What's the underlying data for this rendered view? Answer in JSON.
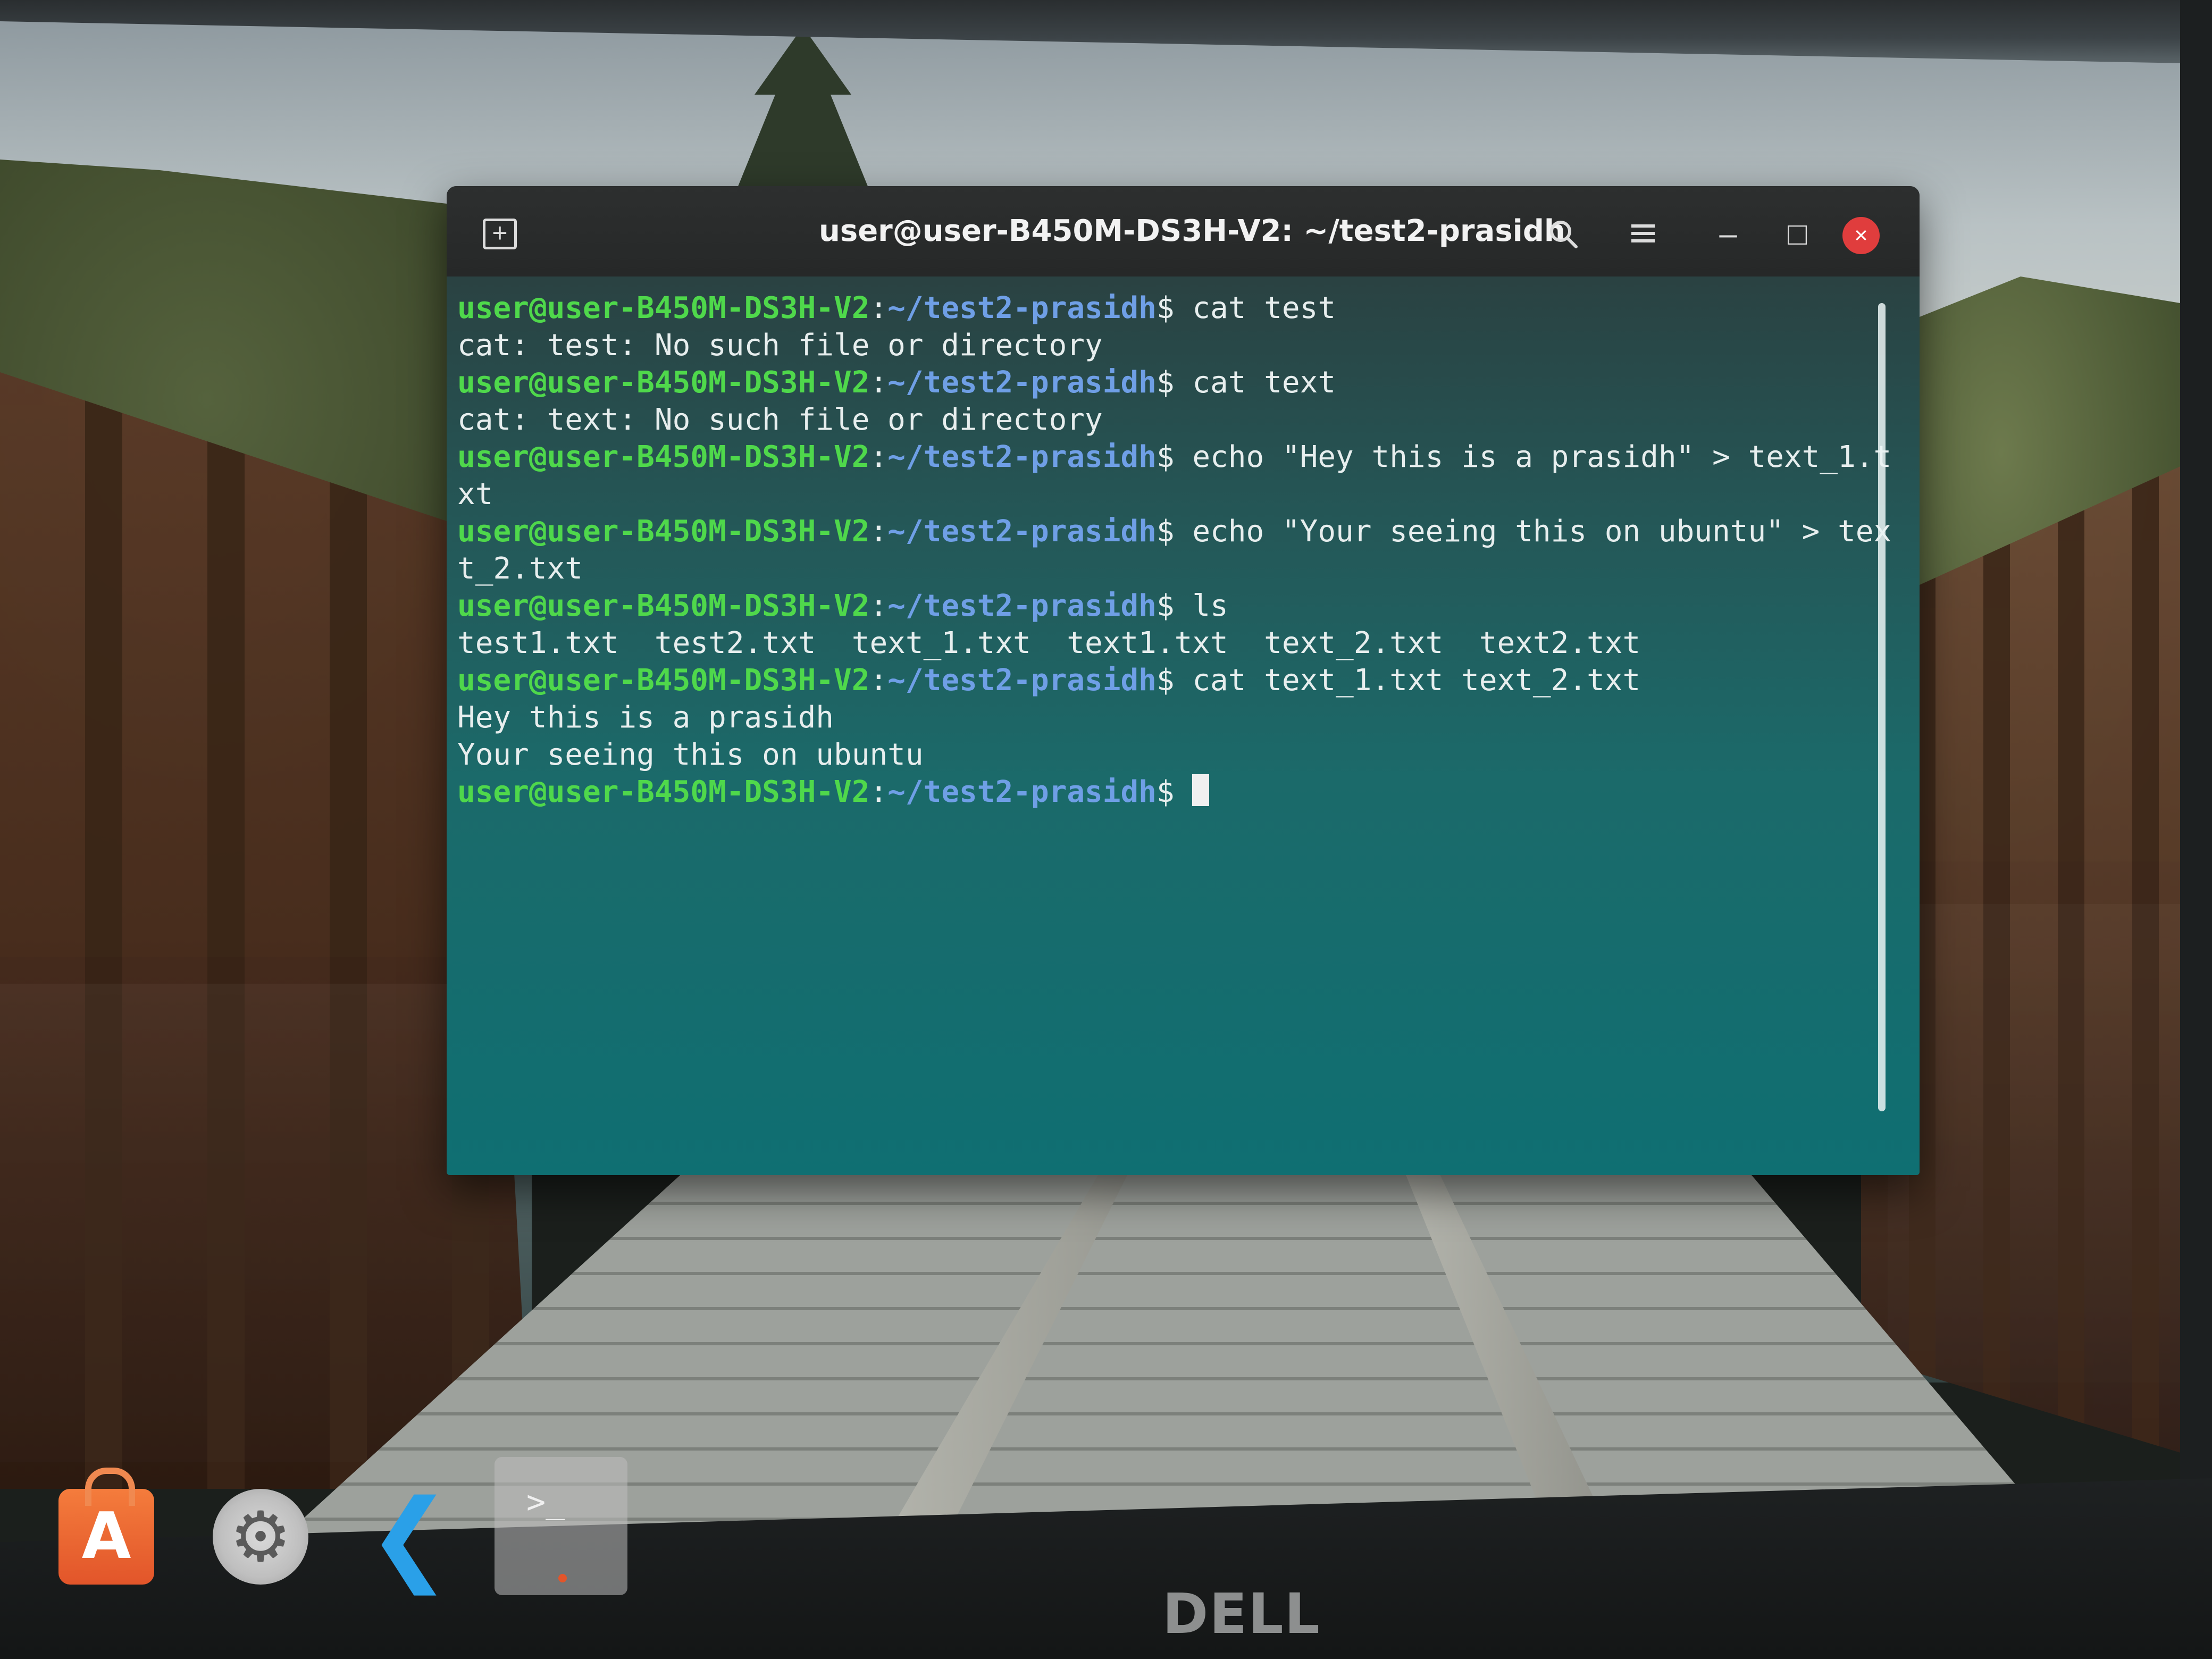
{
  "window": {
    "title": "user@user-B450M-DS3H-V2: ~/test2-prasidh"
  },
  "headerbar": {
    "new_tab_icon": "new-tab-icon",
    "search_icon": "search-icon",
    "menu_icon": "hamburger-menu-icon",
    "minimize_glyph": "–",
    "maximize_glyph": "□",
    "close_glyph": "×",
    "close_color": "#e03d3d"
  },
  "prompt": {
    "user_host": "user@user-B450M-DS3H-V2",
    "separator": ":",
    "path": "~/test2-prasidh",
    "symbol": "$"
  },
  "terminal_lines": [
    {
      "type": "prompt",
      "command": " cat test"
    },
    {
      "type": "output",
      "text": "cat: test: No such file or directory"
    },
    {
      "type": "prompt",
      "command": " cat text"
    },
    {
      "type": "output",
      "text": "cat: text: No such file or directory"
    },
    {
      "type": "prompt",
      "command": " echo \"Hey this is a prasidh\" > text_1.t"
    },
    {
      "type": "output",
      "text": "xt"
    },
    {
      "type": "prompt",
      "command": " echo \"Your seeing this on ubuntu\" > tex"
    },
    {
      "type": "output",
      "text": "t_2.txt"
    },
    {
      "type": "prompt",
      "command": " ls"
    },
    {
      "type": "output",
      "text": "test1.txt  test2.txt  text_1.txt  text1.txt  text_2.txt  text2.txt"
    },
    {
      "type": "prompt",
      "command": " cat text_1.txt text_2.txt"
    },
    {
      "type": "output",
      "text": "Hey this is a prasidh"
    },
    {
      "type": "output",
      "text": "Your seeing this on ubuntu"
    },
    {
      "type": "prompt",
      "command": " "
    }
  ],
  "dock": {
    "items": [
      {
        "name": "ubuntu-software-icon",
        "glyph": "A"
      },
      {
        "name": "settings-gear-icon",
        "glyph": "⚙"
      },
      {
        "name": "vscode-icon",
        "glyph": "❮"
      },
      {
        "name": "terminal-app-icon",
        "glyph": ">_"
      }
    ]
  },
  "monitor": {
    "brand": "DELL"
  }
}
